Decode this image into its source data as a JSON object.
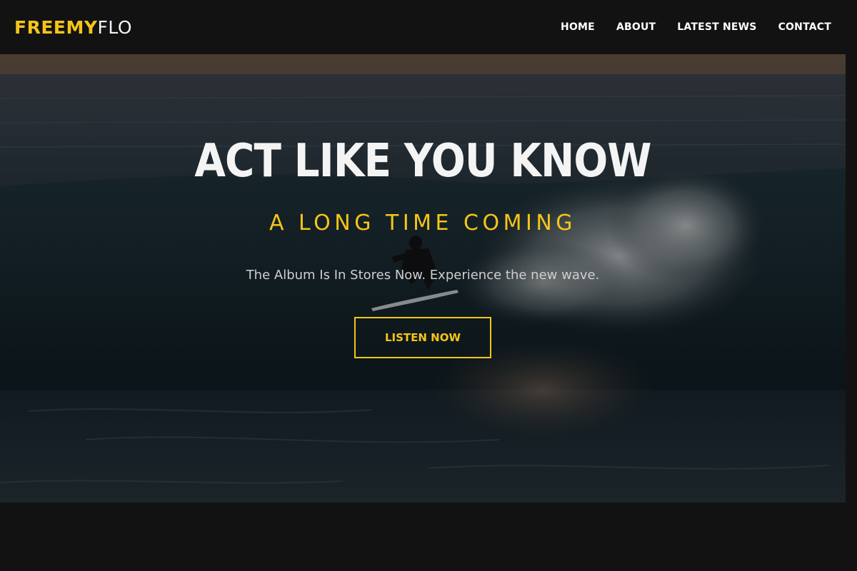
{
  "brand": {
    "logo_bold": "FREEMY",
    "logo_light": "FLO",
    "accent_color": "#f5c518"
  },
  "nav": {
    "items": [
      {
        "label": "HOME"
      },
      {
        "label": "ABOUT"
      },
      {
        "label": "LATEST NEWS"
      },
      {
        "label": "CONTACT"
      }
    ]
  },
  "hero": {
    "background_image": "surfer-riding-wave-at-dusk",
    "title": "ACT LIKE YOU KNOW",
    "subtitle": "A LONG TIME COMING",
    "tagline": "The Album Is In Stores Now. Experience the new wave.",
    "cta_label": "LISTEN NOW"
  }
}
